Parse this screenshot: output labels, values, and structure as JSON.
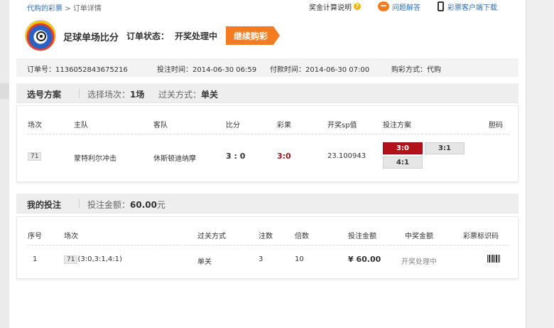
{
  "breadcrumb": {
    "parent": "代购的彩票",
    "sep": ">",
    "current": "订单详情"
  },
  "top_links": {
    "prize_calc": "奖金计算说明",
    "faq": "问题解答",
    "download": "彩票客户端下载"
  },
  "header": {
    "title": "足球单场比分",
    "status_label": "订单状态：",
    "status": "开奖处理中",
    "continue_btn": "继续购彩"
  },
  "order_info": {
    "order_no": "订单号：1136052843675216",
    "bet_time": "投注时间：2014-06-30 06:59",
    "pay_time": "付款时间：2014-06-30 07:00",
    "buy_mode": "购彩方式：代购"
  },
  "selection": {
    "title": "选号方案",
    "matches_label": "选择场次：",
    "matches_value": "1场",
    "pass_label": "过关方式：",
    "pass_value": "单关",
    "columns": [
      "场次",
      "主队",
      "客队",
      "比分",
      "彩果",
      "开奖sp值",
      "投注方案",
      "胆码"
    ],
    "row": {
      "match_no": "71",
      "home": "蒙特利尔冲击",
      "away": "休斯顿迪纳摩",
      "score": "3 : 0",
      "result": "3:0",
      "sp": "23.100943",
      "options": [
        {
          "label": "3:0",
          "selected": true
        },
        {
          "label": "3:1",
          "selected": false
        },
        {
          "label": "4:1",
          "selected": false
        }
      ]
    }
  },
  "bets": {
    "title": "我的投注",
    "amount_label": "投注金额：",
    "amount_value": "60.00",
    "amount_unit": "元",
    "columns": [
      "序号",
      "场次",
      "过关方式",
      "注数",
      "倍数",
      "投注金额",
      "中奖金额",
      "彩票标识码"
    ],
    "row": {
      "index": "1",
      "match_no": "71",
      "match_detail": "(3:0,3:1,4:1)",
      "pass": "单关",
      "count": "3",
      "multiple": "10",
      "amount": "¥ 60.00",
      "prize": "开奖处理中"
    }
  },
  "colors": {
    "accent": "#f47b20",
    "selected": "#b3121b",
    "link": "#2f6fb6"
  },
  "icons": [
    "question-icon",
    "chat-bubble-icon",
    "phone-icon",
    "barcode-icon",
    "football-logo-icon"
  ]
}
